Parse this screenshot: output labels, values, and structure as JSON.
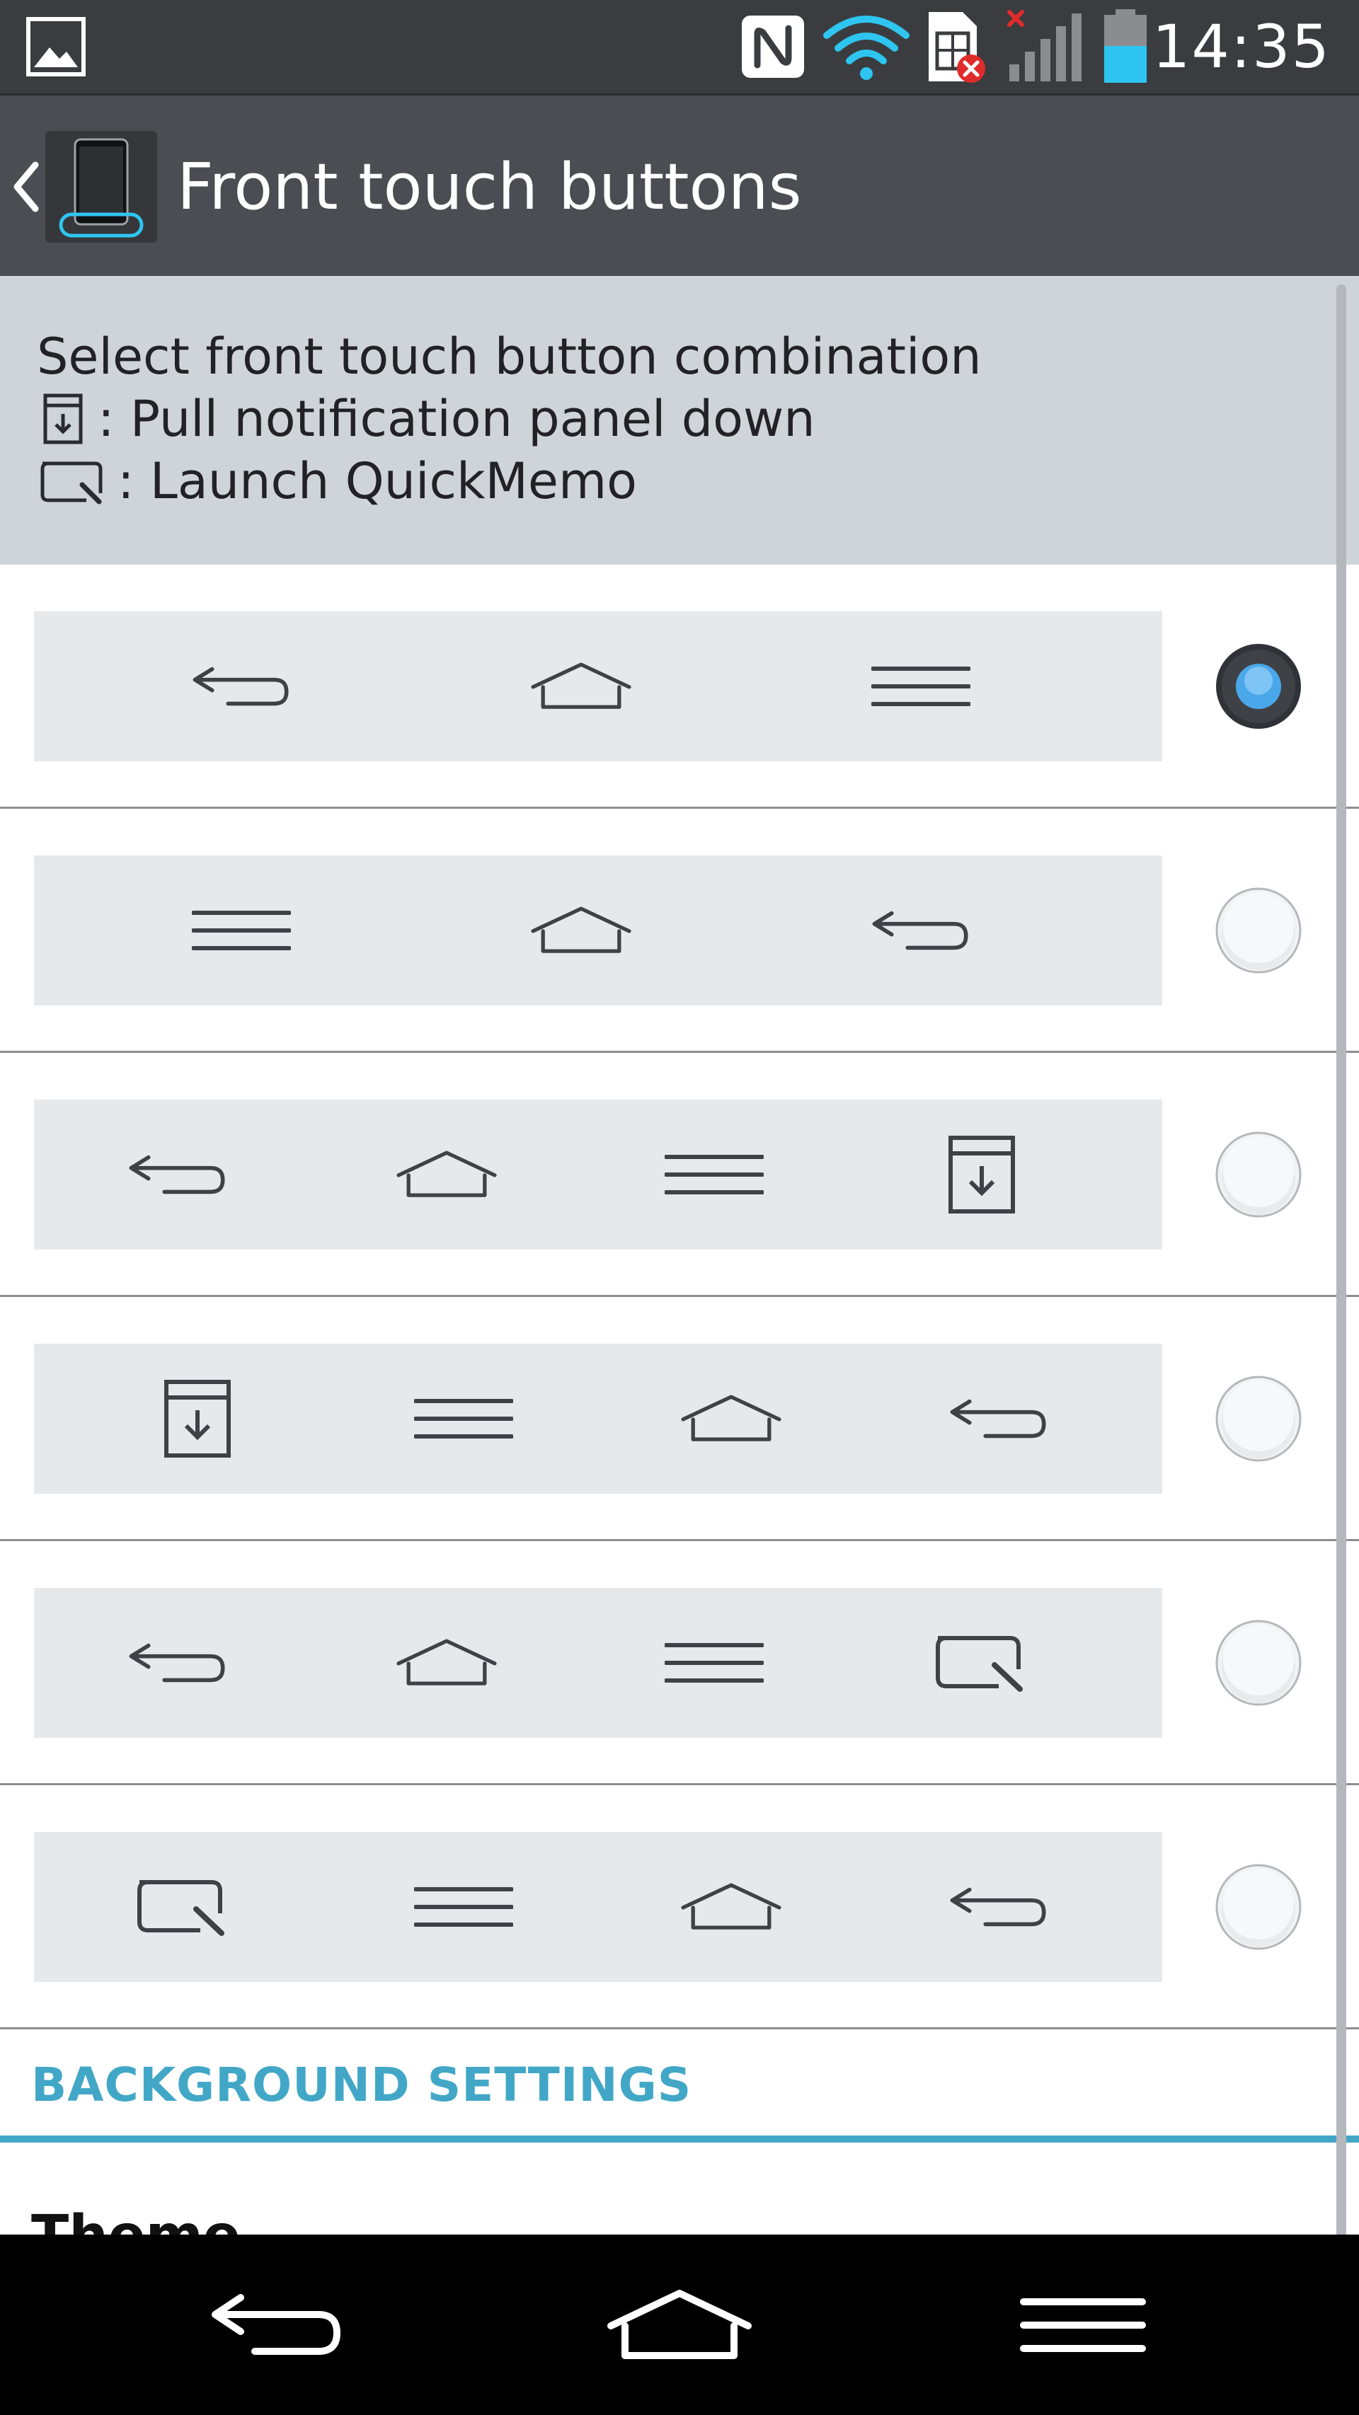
{
  "status_bar": {
    "time": "14:35",
    "icons": [
      "image-icon",
      "nfc-icon",
      "wifi-icon",
      "sim-error-icon",
      "signal-icon",
      "battery-icon"
    ]
  },
  "header": {
    "title": "Front touch buttons",
    "back_icon": "chevron-left-icon",
    "app_icon": "phone-icon"
  },
  "description": {
    "line1": "Select front touch button combination",
    "line2": ": Pull notification panel down",
    "line3": ": Launch QuickMemo"
  },
  "options": [
    {
      "buttons": [
        "back",
        "home",
        "menu"
      ],
      "selected": true
    },
    {
      "buttons": [
        "menu",
        "home",
        "back"
      ],
      "selected": false
    },
    {
      "buttons": [
        "back",
        "home",
        "menu",
        "notification"
      ],
      "selected": false
    },
    {
      "buttons": [
        "notification",
        "menu",
        "home",
        "back"
      ],
      "selected": false
    },
    {
      "buttons": [
        "back",
        "home",
        "menu",
        "quickmemo"
      ],
      "selected": false
    },
    {
      "buttons": [
        "quickmemo",
        "menu",
        "home",
        "back"
      ],
      "selected": false
    }
  ],
  "section": {
    "title": "BACKGROUND SETTINGS"
  },
  "theme": {
    "label": "Theme"
  },
  "nav_bar": {
    "buttons": [
      "back-icon",
      "home-icon",
      "menu-icon"
    ]
  },
  "colors": {
    "accent": "#42a7c7",
    "radio_selected": "#4aa8ea",
    "status_bar": "#3a3c40",
    "action_bar": "#4b4d52",
    "description_bg": "#cfd4d9"
  }
}
